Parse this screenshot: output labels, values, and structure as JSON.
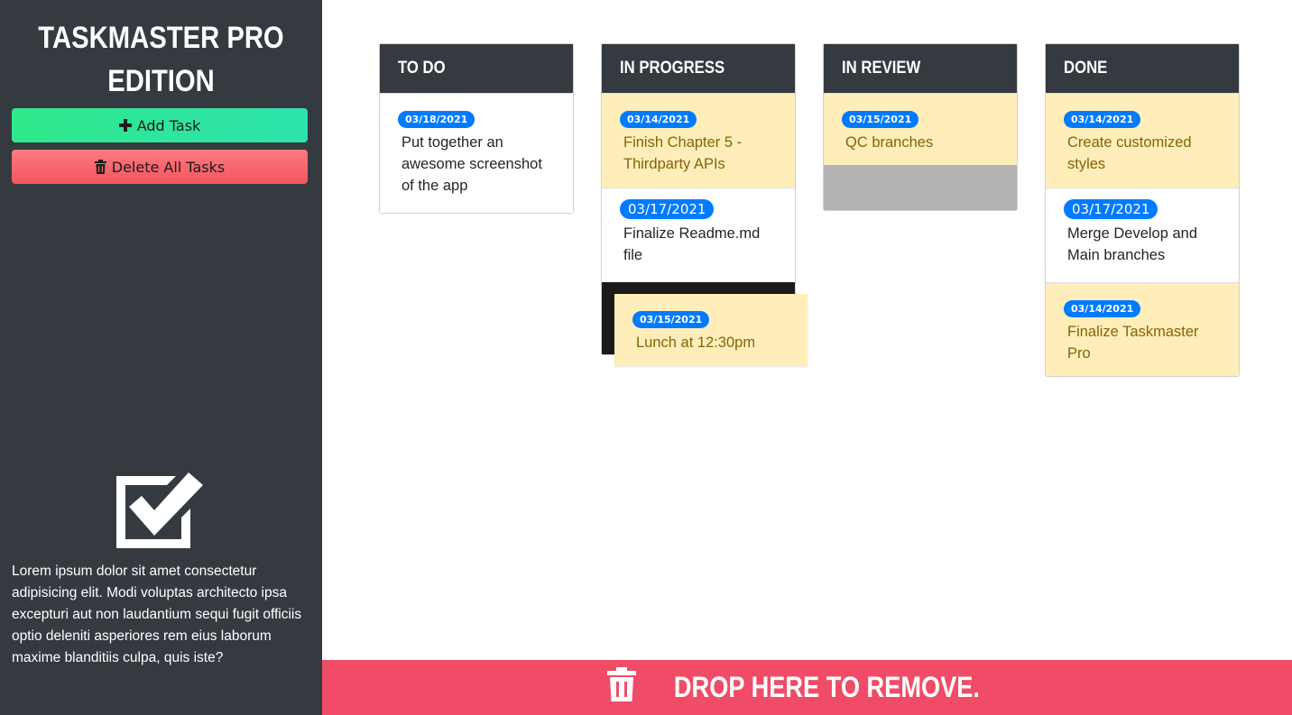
{
  "sidebar": {
    "title": "Taskmaster Pro Edition",
    "add_button": "Add Task",
    "delete_button": "Delete All Tasks",
    "description": "Lorem ipsum dolor sit amet consectetur adipisicing elit. Modi voluptas architecto ipsa excepturi aut non laudantium sequi fugit officiis optio deleniti asperiores rem eius laborum maxime blanditiis culpa, quis iste?"
  },
  "columns": {
    "todo": {
      "title": "To Do",
      "cards": [
        {
          "date": "03/18/2021",
          "text": "Put together an awesome screenshot of the app",
          "status": "normal"
        }
      ]
    },
    "inprogress": {
      "title": "In Progress",
      "cards": [
        {
          "date": "03/14/2021",
          "text": "Finish Chapter 5 - Thirdparty APIs",
          "status": "warning"
        },
        {
          "date": "03/17/2021",
          "text": "Finalize Readme.md file",
          "status": "normal"
        }
      ]
    },
    "inreview": {
      "title": "In Review",
      "cards": [
        {
          "date": "03/15/2021",
          "text": "QC branches",
          "status": "warning"
        }
      ]
    },
    "done": {
      "title": "Done",
      "cards": [
        {
          "date": "03/14/2021",
          "text": "Create customized styles",
          "status": "warning"
        },
        {
          "date": "03/17/2021",
          "text": "Merge Develop and Main branches",
          "status": "normal"
        },
        {
          "date": "03/14/2021",
          "text": "Finalize Taskmaster Pro",
          "status": "warning"
        }
      ]
    }
  },
  "dragging_card": {
    "date": "03/15/2021",
    "text": "Lunch at 12:30pm",
    "status": "warning"
  },
  "trash": {
    "label": "Drop here to remove."
  },
  "colors": {
    "sidebar_bg": "#343a40",
    "badge": "#007bff",
    "warning_bg": "#ffeeba",
    "trash_bg": "#f04c67",
    "add_gradient_start": "#2ee88a",
    "delete_gradient": "#f05660"
  },
  "icons": {
    "add": "plus-icon",
    "delete": "trash-icon",
    "logo": "checkbox-checked-icon",
    "trash": "trash-icon"
  }
}
